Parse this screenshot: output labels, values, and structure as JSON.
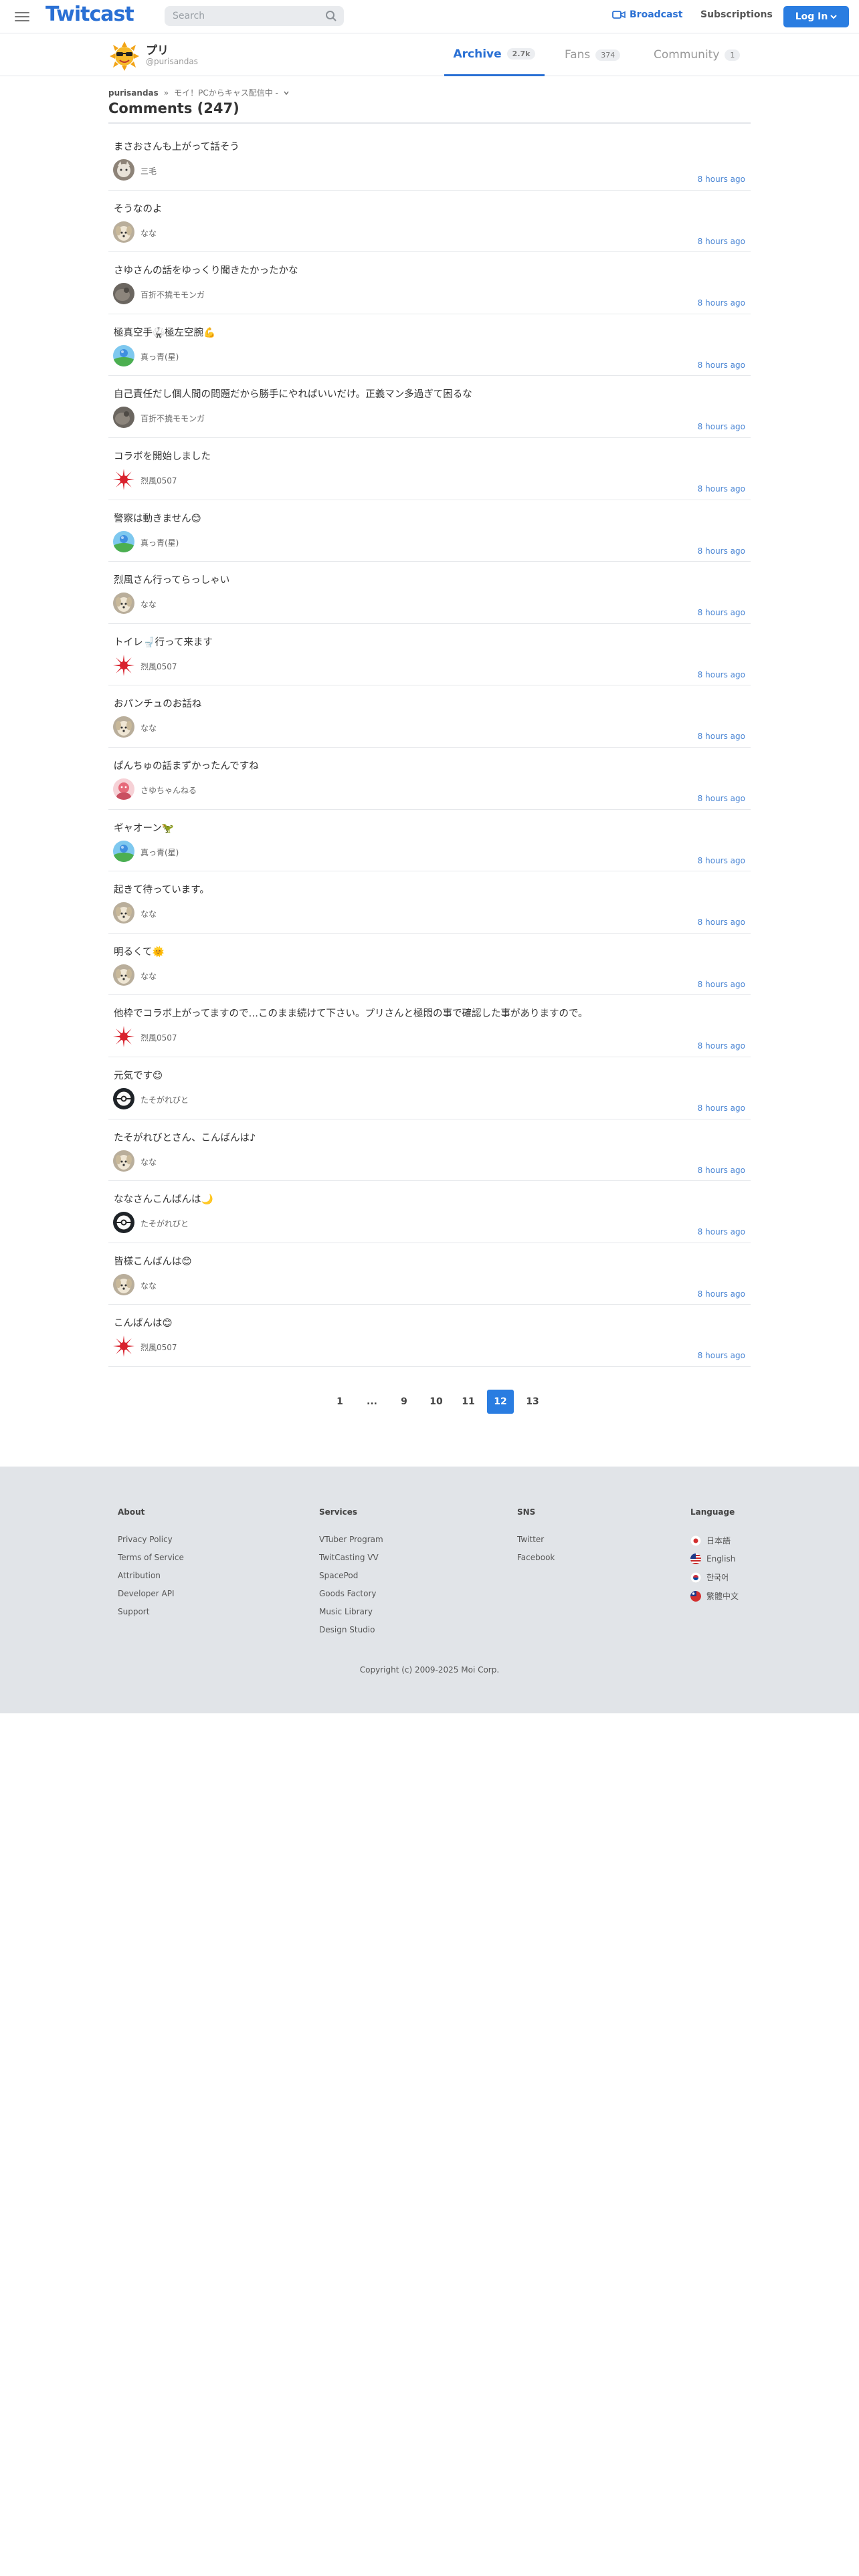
{
  "header": {
    "logo": "Twitcast",
    "search_placeholder": "Search",
    "broadcast": "Broadcast",
    "subscriptions": "Subscriptions",
    "login": "Log In"
  },
  "profile": {
    "name": "プリ",
    "handle": "@purisandas",
    "tabs": [
      {
        "label": "Archive",
        "count": "2.7k"
      },
      {
        "label": "Fans",
        "count": "374"
      },
      {
        "label": "Community",
        "count": "1"
      }
    ]
  },
  "breadcrumb": {
    "user": "purisandas",
    "sep": "»",
    "movie": "モイ！PCからキャス配信中 -"
  },
  "comments_title": "Comments (247)",
  "comments": [
    {
      "text": "まさおさんも上がって話そう",
      "user": "三毛",
      "time": "8 hours ago",
      "avatar": "cat"
    },
    {
      "text": "そうなのよ",
      "user": "なな",
      "time": "8 hours ago",
      "avatar": "dog"
    },
    {
      "text": "さゆさんの話をゆっくり聞きたかったかな",
      "user": "百折不撓モモンガ",
      "time": "8 hours ago",
      "avatar": "rock"
    },
    {
      "text": "極真空手🥋極左空腕💪",
      "user": "真っ青(星)",
      "time": "8 hours ago",
      "avatar": "planet"
    },
    {
      "text": "自己責任だし個人間の問題だから勝手にやればいいだけ。正義マン多過ぎて困るな",
      "user": "百折不撓モモンガ",
      "time": "8 hours ago",
      "avatar": "rock"
    },
    {
      "text": "コラボを開始しました",
      "user": "烈風0507",
      "time": "8 hours ago",
      "avatar": "sun"
    },
    {
      "text": "警察は動きません😊",
      "user": "真っ青(星)",
      "time": "8 hours ago",
      "avatar": "planet"
    },
    {
      "text": "烈風さん行ってらっしゃい",
      "user": "なな",
      "time": "8 hours ago",
      "avatar": "dog"
    },
    {
      "text": "トイレ🚽行って来ます",
      "user": "烈風0507",
      "time": "8 hours ago",
      "avatar": "sun"
    },
    {
      "text": "おパンチュのお話ね",
      "user": "なな",
      "time": "8 hours ago",
      "avatar": "dog"
    },
    {
      "text": "ぱんちゅの話まずかったんですね",
      "user": "さゆちゃんねる",
      "time": "8 hours ago",
      "avatar": "pink"
    },
    {
      "text": "ギャオーン🦖",
      "user": "真っ青(星)",
      "time": "8 hours ago",
      "avatar": "planet"
    },
    {
      "text": "起きて待っています。",
      "user": "なな",
      "time": "8 hours ago",
      "avatar": "dog"
    },
    {
      "text": "明るくて🌞",
      "user": "なな",
      "time": "8 hours ago",
      "avatar": "dog"
    },
    {
      "text": "他枠でコラボ上がってますので…このまま続けて下さい。プリさんと極悶の事で確認した事がありますので。",
      "user": "烈風0507",
      "time": "8 hours ago",
      "avatar": "sun"
    },
    {
      "text": "元気です😊",
      "user": "たそがれびと",
      "time": "8 hours ago",
      "avatar": "ball"
    },
    {
      "text": "たそがれびとさん、こんばんは♪",
      "user": "なな",
      "time": "8 hours ago",
      "avatar": "dog"
    },
    {
      "text": "ななさんこんばんは🌙",
      "user": "たそがれびと",
      "time": "8 hours ago",
      "avatar": "ball"
    },
    {
      "text": "皆様こんばんは😊",
      "user": "なな",
      "time": "8 hours ago",
      "avatar": "dog"
    },
    {
      "text": "こんばんは😊",
      "user": "烈風0507",
      "time": "8 hours ago",
      "avatar": "sun"
    }
  ],
  "pagination": {
    "pages": [
      "1",
      "...",
      "9",
      "10",
      "11",
      "12",
      "13"
    ],
    "current": "12"
  },
  "footer": {
    "about": {
      "title": "About",
      "links": [
        "Privacy Policy",
        "Terms of Service",
        "Attribution",
        "Developer API",
        "Support"
      ]
    },
    "services": {
      "title": "Services",
      "links": [
        "VTuber Program",
        "TwitCasting VV",
        "SpacePod",
        "Goods Factory",
        "Music Library",
        "Design Studio"
      ]
    },
    "sns": {
      "title": "SNS",
      "links": [
        "Twitter",
        "Facebook"
      ]
    },
    "language": {
      "title": "Language",
      "items": [
        {
          "label": "日本語",
          "flag": "jp"
        },
        {
          "label": "English",
          "flag": "us"
        },
        {
          "label": "한국어",
          "flag": "kr"
        },
        {
          "label": "繁體中文",
          "flag": "tw"
        }
      ]
    },
    "copyright": "Copyright (c) 2009-2025 Moi Corp."
  },
  "colors": {
    "accent": "#2a7de1",
    "link": "#2a70d4",
    "time": "#4b86d4",
    "footer_bg": "#e1e4e8"
  }
}
